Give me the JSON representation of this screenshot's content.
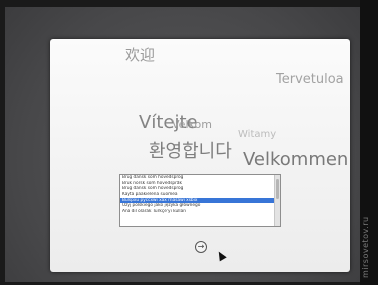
{
  "welcome_words": [
    "欢迎",
    "Tervetuloa",
    "Vítejte",
    "Velkom",
    "Witamy",
    "환영합니다",
    "Velkommen"
  ],
  "language_list": {
    "items": [
      "Brug dansk som hovedsprog",
      "Bruk norsk som hovedspråk",
      "Brug dansk som hovedsprog",
      "Käytä pääkielenä suomea",
      "Bulspxu pyccxwi xax rnasawi xsbix",
      "Użyj polskiego jako języka głównego",
      "Ana dil olarak Türkçe'yi kullan"
    ],
    "selected_index": 4
  },
  "continue_button_icon": "right-arrow-circle-icon",
  "watermark": "mirsovetov.ru"
}
